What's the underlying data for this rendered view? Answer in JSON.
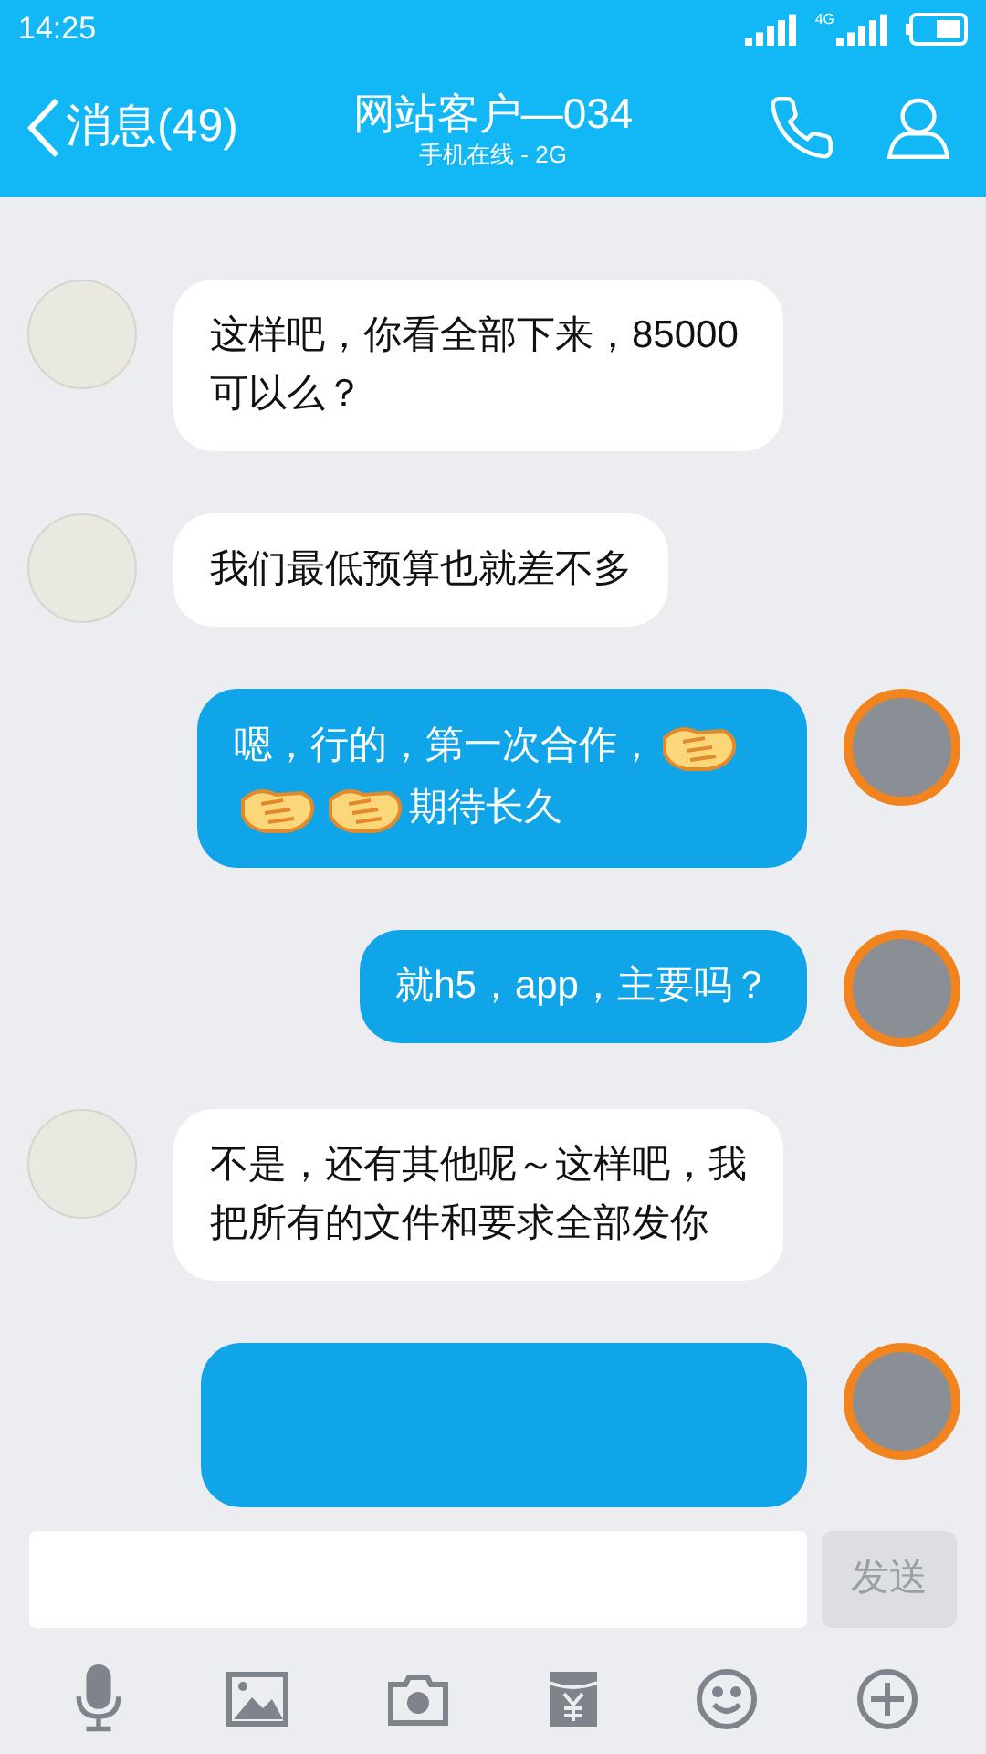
{
  "status_bar": {
    "time": "14:25",
    "network": "4G"
  },
  "header": {
    "back_label": "消息(49)",
    "title": "网站客户—034",
    "subtitle": "手机在线 - 2G"
  },
  "messages": [
    {
      "kind": "incoming",
      "parts": [
        {
          "kind": "text",
          "text": "这样吧，你看全部下来，85000可以么？"
        }
      ]
    },
    {
      "kind": "incoming",
      "parts": [
        {
          "kind": "text",
          "text": "我们最低预算也就差不多"
        }
      ]
    },
    {
      "kind": "outgoing",
      "parts": [
        {
          "kind": "text",
          "text": "嗯，行的，第一次合作，"
        },
        {
          "kind": "handshake"
        },
        {
          "kind": "handshake"
        },
        {
          "kind": "handshake"
        },
        {
          "kind": "text",
          "text": "期待长久"
        }
      ]
    },
    {
      "kind": "outgoing",
      "parts": [
        {
          "kind": "text",
          "text": "就h5，app，主要吗？"
        }
      ]
    },
    {
      "kind": "incoming",
      "parts": [
        {
          "kind": "text",
          "text": "不是，还有其他呢～这样吧，我把所有的文件和要求全部发你"
        }
      ]
    },
    {
      "kind": "outgoing"
    }
  ],
  "composer": {
    "send_label": "发送",
    "send_disabled": true
  }
}
